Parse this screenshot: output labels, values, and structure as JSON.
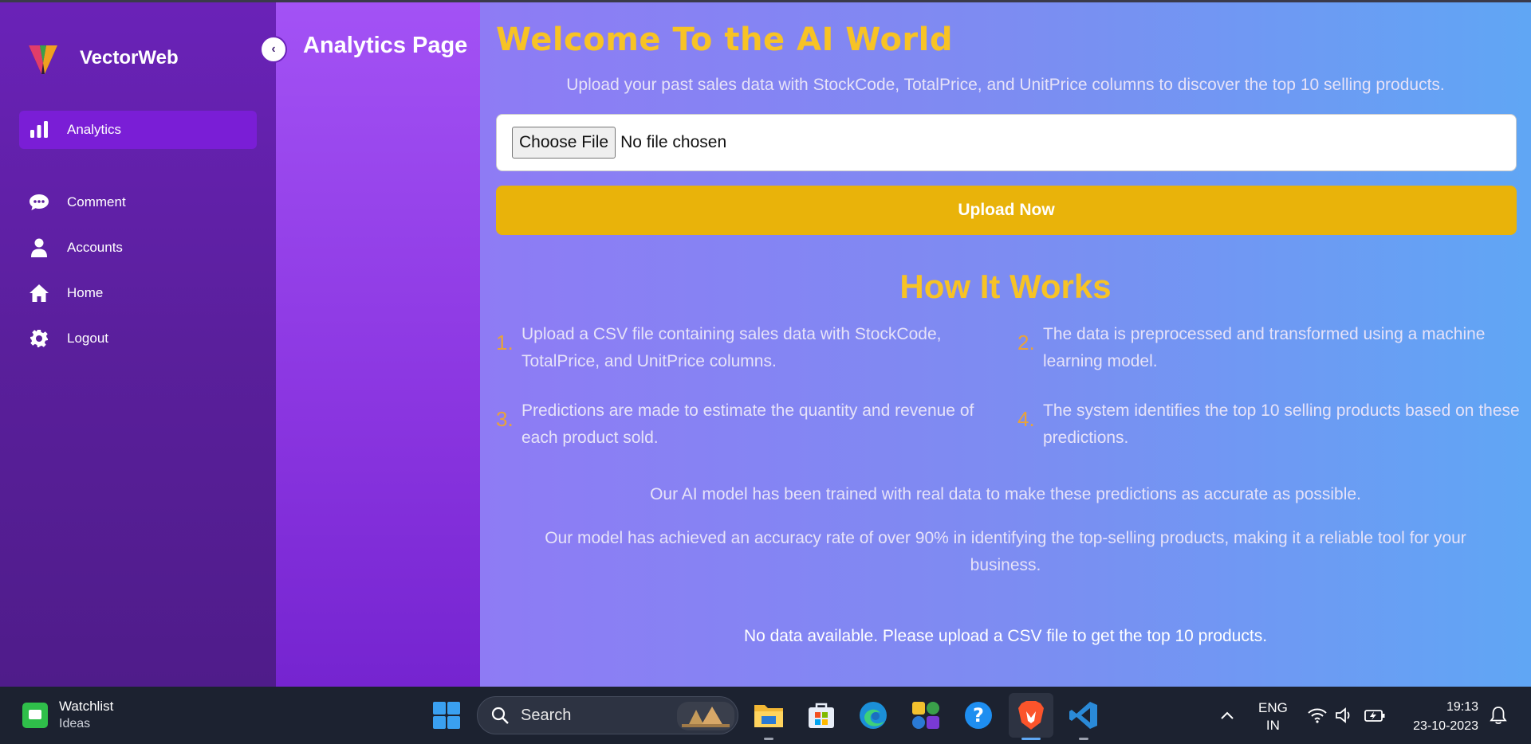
{
  "app": {
    "name": "VectorWeb"
  },
  "sidebar": {
    "items": [
      {
        "label": "Analytics",
        "icon": "bar-chart-icon",
        "active": true
      },
      {
        "label": "Comment",
        "icon": "comment-icon"
      },
      {
        "label": "Accounts",
        "icon": "user-icon"
      },
      {
        "label": "Home",
        "icon": "home-icon"
      },
      {
        "label": "Logout",
        "icon": "gear-icon"
      }
    ]
  },
  "header": {
    "title": "Analytics Page"
  },
  "main": {
    "welcome": "Welcome To the AI World",
    "subtitle": "Upload your past sales data with StockCode, TotalPrice, and UnitPrice columns to discover the top 10 selling products.",
    "file_input": {
      "button_label": "Choose File",
      "status": "No file chosen"
    },
    "upload_label": "Upload Now",
    "how_title": "How It Works",
    "steps": [
      {
        "num": "1.",
        "text": "Upload a CSV file containing sales data with StockCode, TotalPrice, and UnitPrice columns."
      },
      {
        "num": "2.",
        "text": "The data is preprocessed and transformed using a machine learning model."
      },
      {
        "num": "3.",
        "text": "Predictions are made to estimate the quantity and revenue of each product sold."
      },
      {
        "num": "4.",
        "text": "The system identifies the top 10 selling products based on these predictions."
      }
    ],
    "note1": "Our AI model has been trained with real data to make these predictions as accurate as possible.",
    "note2": "Our model has achieved an accuracy rate of over 90% in identifying the top-selling products, making it a reliable tool for your business.",
    "no_data": "No data available. Please upload a CSV file to get the top 10 products."
  },
  "taskbar": {
    "widget_title": "Watchlist",
    "widget_sub": "Ideas",
    "search_label": "Search",
    "lang_1": "ENG",
    "lang_2": "IN",
    "time": "19:13",
    "date": "23-10-2023"
  },
  "colors": {
    "accent_yellow": "#f7c325",
    "upload_button": "#e9b30a",
    "sidebar_active": "#7a1ed6"
  }
}
